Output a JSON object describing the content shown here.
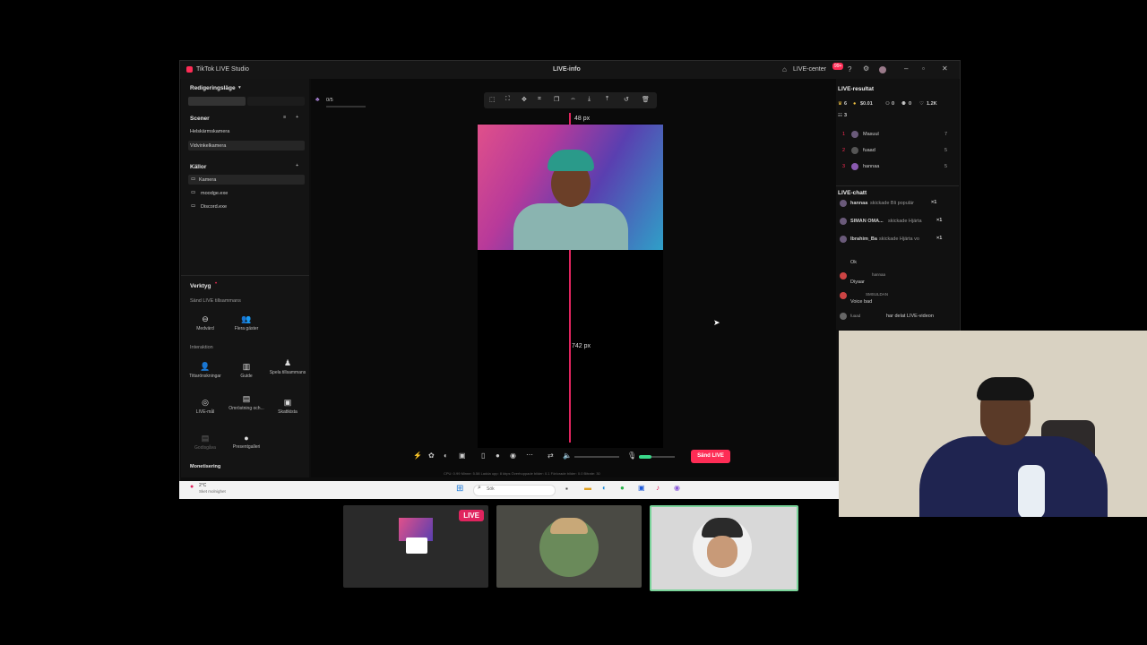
{
  "window": {
    "app_title": "TikTok LIVE Studio",
    "center_title": "LIVE-info",
    "live_center": "LIVE-center",
    "badge": "99+"
  },
  "left": {
    "mode_label": "Redigeringsläge",
    "scenes_title": "Scener",
    "scenes": [
      "Helskärmskamera",
      "Vidvinkelkamera"
    ],
    "sources_title": "Källor",
    "sources": [
      "Kamera",
      "moodge.exe",
      "Discord.exe"
    ],
    "tools_title": "Verktyg",
    "send_together": "Sänd LIVE tillsammans",
    "tools_row1": [
      "Medvärd",
      "Flera gäster"
    ],
    "interaction_title": "Interaktion",
    "tools_row2": [
      "Tittarönskningar",
      "Guide",
      "Spela tillsammans"
    ],
    "tools_row3": [
      "LIVE-mål",
      "Omröstning och...",
      "Skattkista"
    ],
    "tools_row4": [
      "Godisgåva",
      "Presentgalleri"
    ],
    "monetization_title": "Monetisering"
  },
  "canvas": {
    "scene_counter": "0/5",
    "top_measure": "48 px",
    "mid_measure": "742 px",
    "send_live": "Sänd LIVE",
    "stats": "CPU: 0.99    Minne: 5.58    Ladda upp: 8 kbps    Överhoppade bilder: 0.1    Förlorade bilder: 0.0    Bitrate: 30"
  },
  "right": {
    "results_title": "LIVE-resultat",
    "stats": [
      "6",
      "$0.01",
      "0",
      "0",
      "1.2K",
      "3"
    ],
    "leaderboard": [
      {
        "rank": "1",
        "name": "Masuul",
        "score": "7"
      },
      {
        "rank": "2",
        "name": "fuaad",
        "score": "5"
      },
      {
        "rank": "3",
        "name": "hannaa",
        "score": "5"
      }
    ],
    "chat_title": "LIVE-chatt",
    "chat": [
      {
        "user": "hannaa",
        "text": "skickade Bli populär",
        "count": "×1"
      },
      {
        "user": "SIMAN OMA...",
        "text": "skickade Hjärta",
        "count": "×1"
      },
      {
        "user": "Ibrahim_Ba",
        "text": "skickade Hjärta vo",
        "count": "×1"
      },
      {
        "user": "",
        "text": "Ok",
        "count": ""
      },
      {
        "user": "hannaa",
        "text": "Diyaar",
        "count": ""
      },
      {
        "user": "SMSULDAN",
        "text": "Voice bad",
        "count": ""
      },
      {
        "user": "fuaad",
        "text": "har delat LIVE-videon",
        "count": ""
      }
    ]
  },
  "taskbar": {
    "weather": "2°C",
    "weather_sub": "Sket molnighet",
    "search": "Sök"
  },
  "tiles": {
    "live_badge": "LIVE"
  },
  "colors": {
    "accent": "#fe2c55",
    "tile_border": "#7ad39a"
  }
}
